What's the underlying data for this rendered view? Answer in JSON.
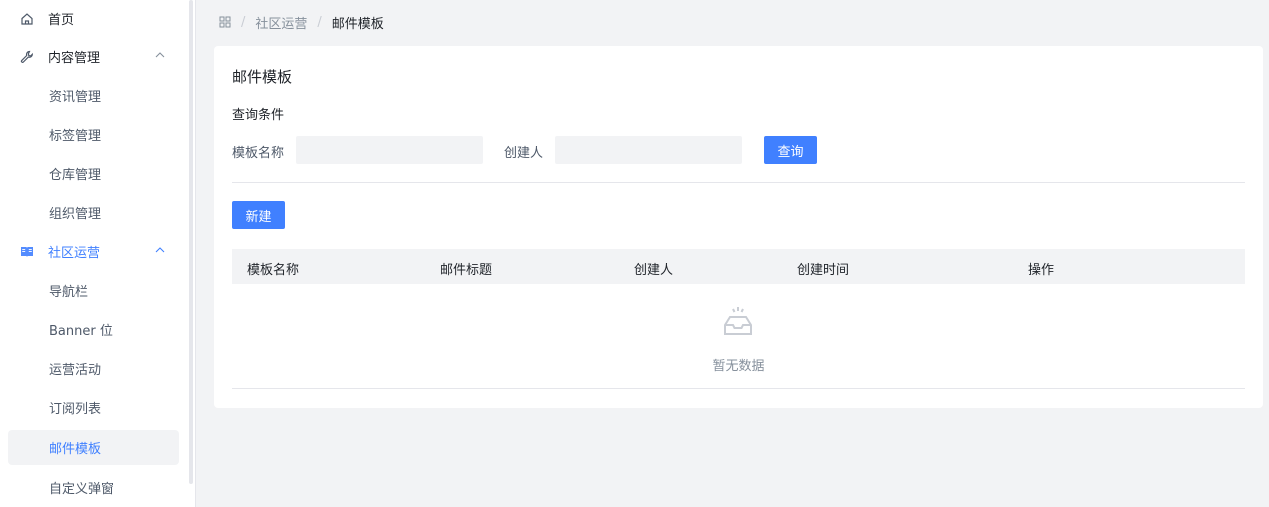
{
  "sidebar": {
    "items": [
      {
        "label": "首页",
        "icon": "home-icon"
      },
      {
        "label": "内容管理",
        "icon": "wrench-icon",
        "expanded": true
      },
      {
        "label": "资讯管理"
      },
      {
        "label": "标签管理"
      },
      {
        "label": "仓库管理"
      },
      {
        "label": "组织管理"
      },
      {
        "label": "社区运营",
        "icon": "book-icon",
        "expanded": true
      },
      {
        "label": "导航栏"
      },
      {
        "label": "Banner 位"
      },
      {
        "label": "运营活动"
      },
      {
        "label": "订阅列表"
      },
      {
        "label": "邮件模板",
        "active": true
      },
      {
        "label": "自定义弹窗"
      }
    ]
  },
  "breadcrumb": {
    "icon": "apps-icon",
    "items": [
      "社区运营",
      "邮件模板"
    ],
    "separator": "/"
  },
  "card": {
    "title": "邮件模板",
    "query_section": "查询条件",
    "fields": {
      "template_name_label": "模板名称",
      "template_name_value": "",
      "creator_label": "创建人",
      "creator_value": ""
    },
    "query_button": "查询",
    "new_button": "新建"
  },
  "table": {
    "columns": [
      "模板名称",
      "邮件标题",
      "创建人",
      "创建时间",
      "操作"
    ],
    "rows": [],
    "empty_text": "暂无数据"
  },
  "colors": {
    "primary": "#4080ff",
    "background": "#f2f3f5",
    "active_item_bg": "#f2f3f5"
  }
}
